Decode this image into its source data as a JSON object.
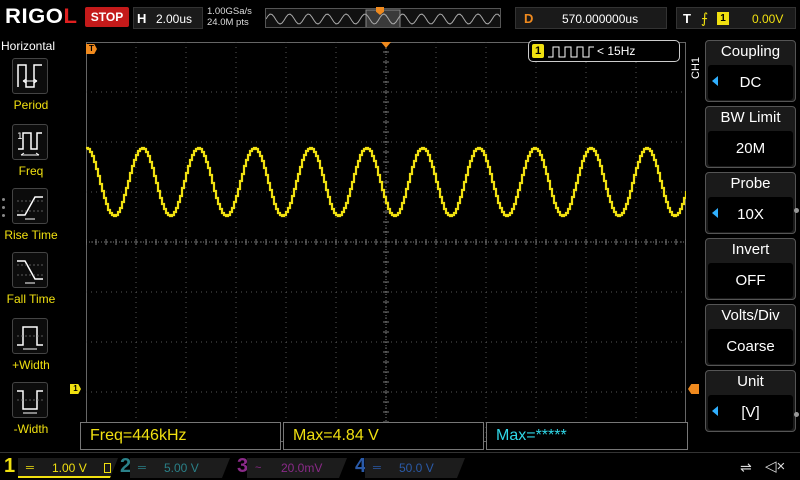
{
  "topbar": {
    "brand_prefix": "RIGO",
    "brand_suffix": "L",
    "run_state": "STOP",
    "horizontal_tag": "H",
    "timebase": "2.00us",
    "sample_rate": "1.00GSa/s",
    "memory_depth": "24.0M pts",
    "delay_tag": "D",
    "delay_value": "570.000000us",
    "trigger_tag": "T",
    "trigger_edge": "rising-edge-icon",
    "trigger_source": "1",
    "trigger_level": "0.00V"
  },
  "left_menu": {
    "title": "Horizontal",
    "items": [
      {
        "label": "Period",
        "icon": "period-icon"
      },
      {
        "label": "Freq",
        "icon": "frequency-icon"
      },
      {
        "label": "Rise Time",
        "icon": "rise-time-icon"
      },
      {
        "label": "Fall Time",
        "icon": "fall-time-icon"
      },
      {
        "label": "+Width",
        "icon": "positive-width-icon"
      },
      {
        "label": "-Width",
        "icon": "negative-width-icon"
      }
    ]
  },
  "freq_indicator": {
    "channel": "1",
    "text": "< 15Hz"
  },
  "markers": {
    "trigger_marker": "T",
    "ch1_marker": "1"
  },
  "measurements": [
    {
      "text": "Freq=446kHz",
      "color": "#f0e010"
    },
    {
      "text": "Max=4.84 V",
      "color": "#f0e010"
    },
    {
      "text": "Max=*****",
      "color": "#30d8e8"
    }
  ],
  "right_menu": {
    "channel_label": "CH1",
    "items": [
      {
        "title": "Coupling",
        "value": "DC",
        "has_arrow": true
      },
      {
        "title": "BW Limit",
        "value": "20M",
        "has_arrow": false
      },
      {
        "title": "Probe",
        "value": "10X",
        "has_arrow": true
      },
      {
        "title": "Invert",
        "value": "OFF",
        "has_arrow": false
      },
      {
        "title": "Volts/Div",
        "value": "Coarse",
        "has_arrow": false
      },
      {
        "title": "Unit",
        "value": "[V]",
        "has_arrow": true
      }
    ]
  },
  "channels": [
    {
      "num": "1",
      "scale": "1.00 V",
      "coupling_symbol": "═",
      "color": "#f0e010",
      "active": true
    },
    {
      "num": "2",
      "scale": "5.00 V",
      "coupling_symbol": "═",
      "color": "#2a8088",
      "active": false
    },
    {
      "num": "3",
      "scale": "20.0mV",
      "coupling_symbol": "~",
      "color": "#8a2a88",
      "active": false
    },
    {
      "num": "4",
      "scale": "50.0 V",
      "coupling_symbol": "═",
      "color": "#2a5aa8",
      "active": false
    }
  ],
  "status_icons": {
    "usb": "usb-icon",
    "sound": "speaker-muted-icon"
  },
  "waveform": {
    "color": "#f0e010",
    "cycles_on_screen": 10.7,
    "trace": "sine"
  }
}
